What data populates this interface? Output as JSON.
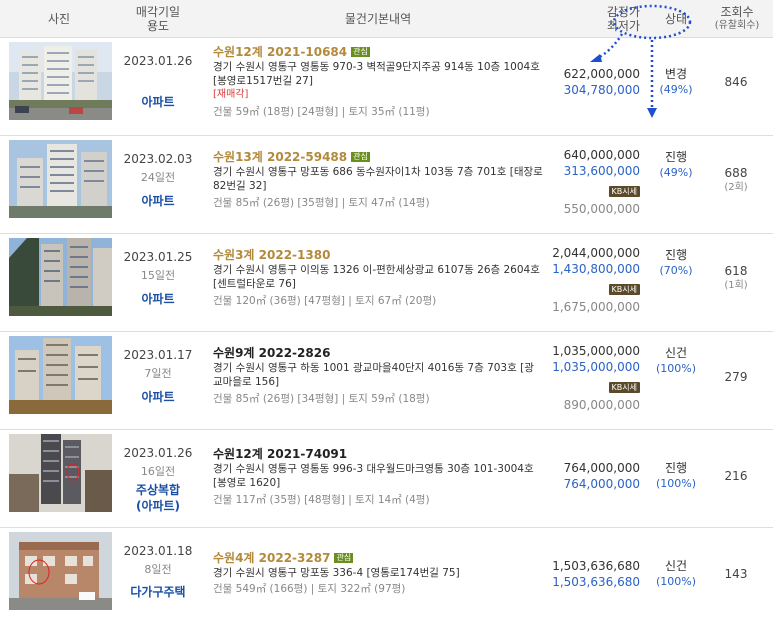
{
  "header": {
    "photo": "사진",
    "date_usage_1": "매각기일",
    "date_usage_2": "용도",
    "details": "물건기본내역",
    "price_1": "감정가",
    "price_2": "최저가",
    "status": "상태",
    "views_1": "조회수",
    "views_2": "(유찰회수)"
  },
  "rows": [
    {
      "date": "2023.01.26",
      "ago": "",
      "usage": "아파트",
      "case": "수원12계 2021-10684",
      "case_style": "gold",
      "tag": "관심",
      "address": "경기 수원시 영통구 영통동 970-3 벽적골9단지주공 914동 10층 1004호 [봉영로1517번길 27]",
      "warning": "[재매각]",
      "area": "건물 59㎡ (18평) [24평형]  |  토지 35㎡ (11평)",
      "appraisal": "622,000,000",
      "min_price": "304,780,000",
      "kb": "",
      "market": "",
      "status": "변경",
      "pct": "(49%)",
      "views": "846",
      "fail": ""
    },
    {
      "date": "2023.02.03",
      "ago": "24일전",
      "usage": "아파트",
      "case": "수원13계 2022-59488",
      "case_style": "gold",
      "tag": "관심",
      "address": "경기 수원시 영통구 망포동 686 동수원자이1차 103동 7층 701호 [태장로82번길 32]",
      "warning": "",
      "area": "건물 85㎡ (26평) [35평형]  |  토지 47㎡ (14평)",
      "appraisal": "640,000,000",
      "min_price": "313,600,000",
      "kb": "KB시세",
      "market": "550,000,000",
      "status": "진행",
      "pct": "(49%)",
      "views": "688",
      "fail": "(2회)"
    },
    {
      "date": "2023.01.25",
      "ago": "15일전",
      "usage": "아파트",
      "case": "수원3계 2022-1380",
      "case_style": "gold",
      "tag": "",
      "address": "경기 수원시 영통구 이의동 1326 이-편한세상광교 6107동 26층 2604호 [센트럴타운로 76]",
      "warning": "",
      "area": "건물 120㎡ (36평) [47평형]  |  토지 67㎡ (20평)",
      "appraisal": "2,044,000,000",
      "min_price": "1,430,800,000",
      "kb": "KB시세",
      "market": "1,675,000,000",
      "status": "진행",
      "pct": "(70%)",
      "views": "618",
      "fail": "(1회)"
    },
    {
      "date": "2023.01.17",
      "ago": "7일전",
      "usage": "아파트",
      "case": "수원9계 2022-2826",
      "case_style": "black",
      "tag": "",
      "address": "경기 수원시 영통구 하동 1001 광교마을40단지 4016동 7층 703호 [광교마을로 156]",
      "warning": "",
      "area": "건물 85㎡ (26평) [34평형]  |  토지 59㎡ (18평)",
      "appraisal": "1,035,000,000",
      "min_price": "1,035,000,000",
      "kb": "KB시세",
      "market": "890,000,000",
      "status": "신건",
      "pct": "(100%)",
      "views": "279",
      "fail": ""
    },
    {
      "date": "2023.01.26",
      "ago": "16일전",
      "usage": "주상복합 (아파트)",
      "case": "수원12계 2021-74091",
      "case_style": "black",
      "tag": "",
      "address": "경기 수원시 영통구 영통동 996-3 대우월드마크영통 30층 101-3004호 [봉영로 1620]",
      "warning": "",
      "area": "건물 117㎡ (35평) [48평형]  |  토지 14㎡ (4평)",
      "appraisal": "764,000,000",
      "min_price": "764,000,000",
      "kb": "",
      "market": "",
      "status": "진행",
      "pct": "(100%)",
      "views": "216",
      "fail": ""
    },
    {
      "date": "2023.01.18",
      "ago": "8일전",
      "usage": "다가구주택",
      "case": "수원4계 2022-3287",
      "case_style": "gold",
      "tag": "관심",
      "address": "경기 수원시 영통구 망포동 336-4 [영통로174번길 75]",
      "warning": "",
      "area": "건물 549㎡ (166평)  |  토지 322㎡ (97평)",
      "appraisal": "1,503,636,680",
      "min_price": "1,503,636,680",
      "kb": "",
      "market": "",
      "status": "신건",
      "pct": "(100%)",
      "views": "143",
      "fail": ""
    }
  ],
  "colors": {
    "case_gold": "#b38a3c",
    "min_price_blue": "#2a62c7",
    "tag_green": "#6a8f1f",
    "usage_blue": "#1a4fa5",
    "annotation_blue": "#1f4fd1",
    "warning_red": "#e03a3a"
  }
}
